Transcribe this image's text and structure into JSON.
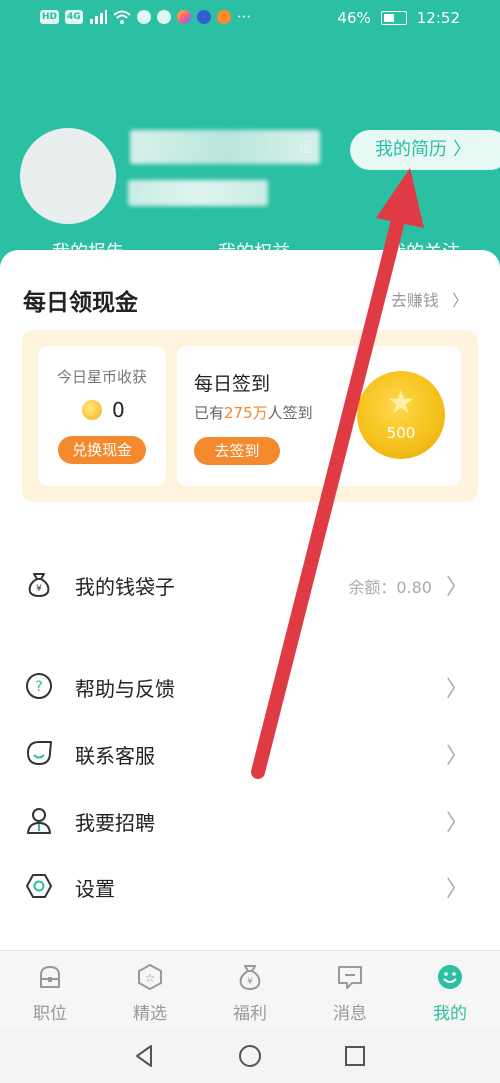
{
  "status_bar": {
    "chips": [
      "HD",
      "4G"
    ],
    "ellipsis": "···",
    "battery": "46%",
    "time": "12:52"
  },
  "profile": {
    "verify_fragment": "证",
    "resume_button": "我的简历",
    "tab_hints": [
      "我的报告",
      "我的权益",
      "我的关注"
    ]
  },
  "daily_cash": {
    "title": "每日领现金",
    "earn_link": "去赚钱",
    "coins_label": "今日星币收获",
    "coins_value": "0",
    "exchange_button": "兑换现金",
    "sign_title": "每日签到",
    "sign_prefix": "已有",
    "sign_count": "275万",
    "sign_suffix": "人签到",
    "sign_button": "去签到",
    "coin_amount": "500"
  },
  "menu": {
    "wallet": {
      "label": "我的钱袋子",
      "extra": "余额：0.80"
    },
    "help": {
      "label": "帮助与反馈"
    },
    "service": {
      "label": "联系客服"
    },
    "recruit": {
      "label": "我要招聘"
    },
    "settings": {
      "label": "设置"
    }
  },
  "tabs": [
    {
      "label": "职位",
      "icon": "briefcase-icon"
    },
    {
      "label": "精选",
      "icon": "star-badge-icon"
    },
    {
      "label": "福利",
      "icon": "money-bag-icon"
    },
    {
      "label": "消息",
      "icon": "chat-icon"
    },
    {
      "label": "我的",
      "icon": "smiley-icon"
    }
  ],
  "colors": {
    "brand": "#2bbfa3",
    "accent_orange": "#f5892e",
    "annotation_arrow": "#e03a45"
  }
}
